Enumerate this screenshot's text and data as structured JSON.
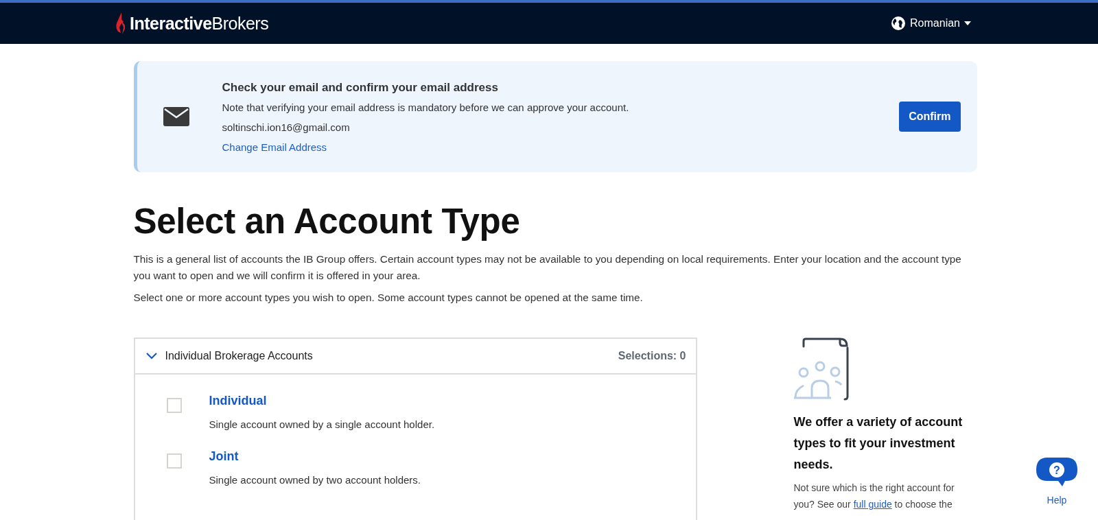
{
  "header": {
    "logo": "**Interactive**Brokers",
    "language": "Romanian"
  },
  "email_banner": {
    "title": "Check your email and confirm your email address",
    "note": "Note that verifying your email address is mandatory before we can approve your account.",
    "email": "soltinschi.ion16@gmail.com",
    "change_link": "Change Email Address",
    "confirm_button": "Confirm"
  },
  "page": {
    "title": "Select an Account Type",
    "intro": "This is a general list of accounts the IB Group offers. Certain account types may not be available to you depending on local requirements. Enter your location and the account type you want to open and we will confirm it is offered in your area.",
    "instruction": "Select one or more account types you wish to open. Some account types cannot be opened at the same time."
  },
  "account_group": {
    "title": "Individual Brokerage Accounts",
    "expanded": true,
    "selections": "Selections: 0",
    "options": [
      {
        "name": "Individual",
        "description": "Single account owned by a single account holder.",
        "checked": false
      },
      {
        "name": "Joint",
        "description": "Single account owned by two account holders.",
        "checked": false
      }
    ]
  },
  "sidebar": {
    "heading": "We offer a variety of account types to fit your investment needs.",
    "text_before": "Not sure which is the right account for you? See our ",
    "link": "full guide",
    "text_after": " to choose the"
  },
  "help": {
    "icon_text": "?",
    "label": "Help"
  }
}
